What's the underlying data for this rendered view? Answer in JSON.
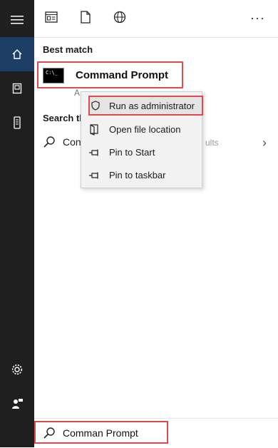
{
  "sidebar": {
    "items": [
      {
        "icon": "hamburger-menu-icon"
      },
      {
        "icon": "home-icon",
        "active": true
      },
      {
        "icon": "documents-icon"
      },
      {
        "icon": "device-icon"
      },
      {
        "icon": "settings-gear-icon"
      },
      {
        "icon": "user-feedback-icon"
      }
    ]
  },
  "toolbar": {
    "tabs": [
      {
        "icon": "apps-icon"
      },
      {
        "icon": "document-icon"
      },
      {
        "icon": "web-globe-icon"
      }
    ],
    "more_label": "···"
  },
  "results": {
    "best_match_label": "Best match",
    "best_match": {
      "title": "Command Prompt",
      "icon_text": "C:\\_",
      "subtitle": "A"
    },
    "search_web_label": "Search th",
    "web_item": {
      "text": "Con",
      "suffix": "ults",
      "chevron": "›"
    }
  },
  "context_menu": {
    "items": [
      {
        "label": "Run as administrator",
        "icon": "shield-icon",
        "highlighted": true
      },
      {
        "label": "Open file location",
        "icon": "open-folder-icon"
      },
      {
        "label": "Pin to Start",
        "icon": "pin-icon"
      },
      {
        "label": "Pin to taskbar",
        "icon": "pin-taskbar-icon"
      }
    ]
  },
  "search": {
    "value": "Comman Prompt"
  },
  "colors": {
    "sidebar_bg": "#1f1f1f",
    "sidebar_active": "#1d3f66",
    "highlight_border": "#e04a4f"
  }
}
